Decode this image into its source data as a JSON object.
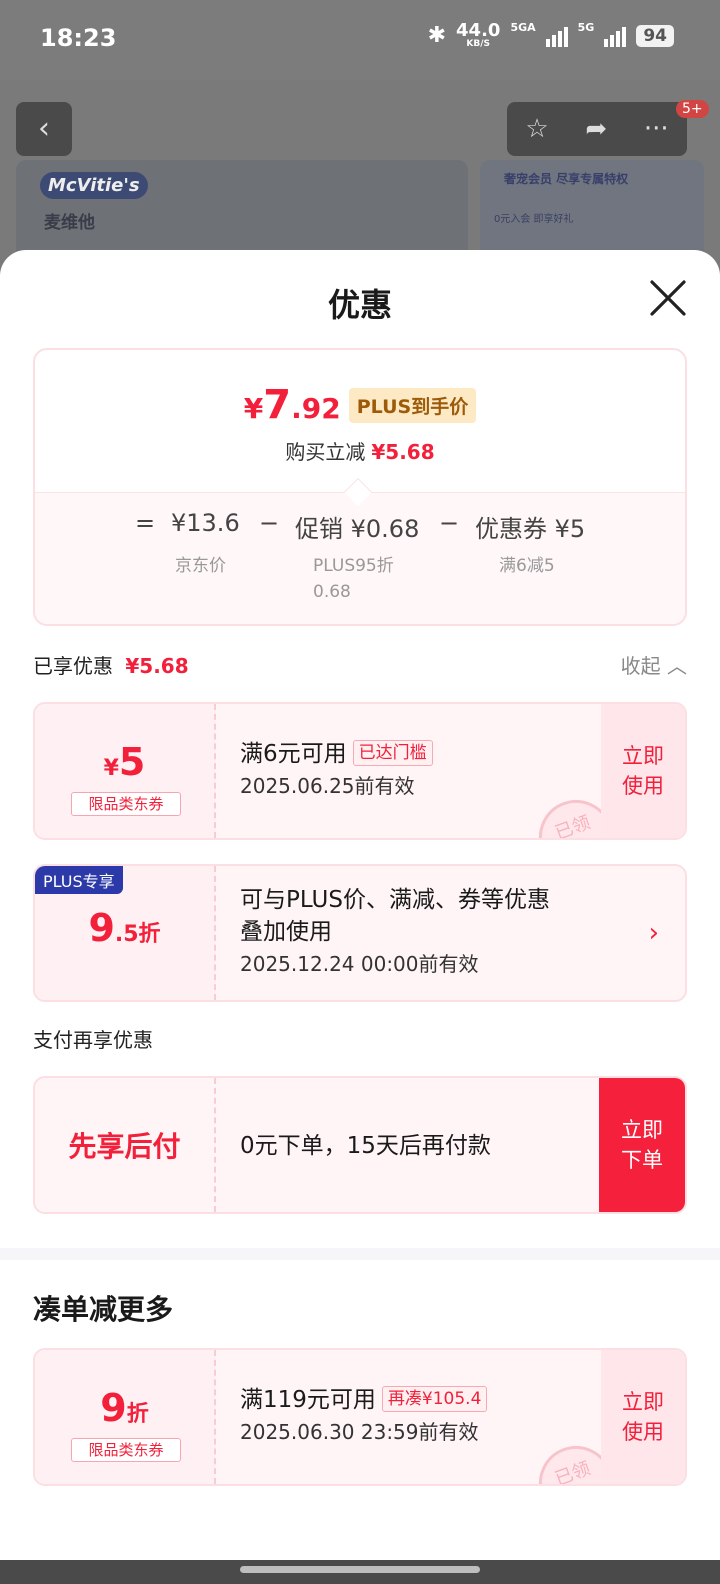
{
  "status_bar": {
    "time": "18:23",
    "speed": "44.0",
    "speed_unit": "KB/S",
    "net1": "5GA",
    "net2": "5G",
    "battery": "94"
  },
  "background": {
    "brand_logo": "McVitie's",
    "brand_cn": "麦维他",
    "member_banner": "奢宠会员 尽享专属特权",
    "member_sub": "0元入会 即享好礼",
    "notification_badge": "5+"
  },
  "sheet": {
    "title": "优惠",
    "summary": {
      "final_price_yen": "¥",
      "final_price_int": "7",
      "final_price_dec": ".92",
      "price_tag": "PLUS到手价",
      "reduce_label": "购买立减",
      "reduce_value": "¥5.68",
      "eq": "=",
      "jd_price": "¥13.6",
      "minus1": "−",
      "promo": "促销 ¥0.68",
      "minus2": "−",
      "coupon": "优惠券 ¥5",
      "jd_price_label": "京东价",
      "promo_label_1": "PLUS95折",
      "promo_label_2": "0.68",
      "coupon_label": "满6减5"
    },
    "enjoyed": {
      "label": "已享优惠",
      "value": "¥5.68",
      "collapse": "收起 ︿"
    },
    "coupon1": {
      "yen": "¥",
      "value": "5",
      "category": "限品类东券",
      "condition": "满6元可用",
      "condition_tag": "已达门槛",
      "valid": "2025.06.25前有效",
      "action_1": "立即",
      "action_2": "使用",
      "stamp": "已领"
    },
    "plus_discount": {
      "badge": "PLUS专享",
      "value_int": "9",
      "value_dec": ".5折",
      "desc_1": "可与PLUS价、满减、券等优惠",
      "desc_2": "叠加使用",
      "valid": "2025.12.24 00:00前有效",
      "chevron": "›"
    },
    "pay_section_title": "支付再享优惠",
    "pay_later": {
      "name": "先享后付",
      "desc": "0元下单，15天后再付款",
      "action_1": "立即",
      "action_2": "下单"
    },
    "more_title": "凑单减更多",
    "coupon2": {
      "value": "9",
      "unit": "折",
      "category": "限品类东券",
      "condition": "满119元可用",
      "condition_tag": "再凑¥105.4",
      "valid": "2025.06.30 23:59前有效",
      "action_1": "立即",
      "action_2": "使用",
      "stamp": "已领"
    }
  },
  "colors": {
    "accent_red": "#f2203a",
    "plus_blue": "#2b3aa8",
    "plus_gold_bg": "#fde9c4"
  }
}
